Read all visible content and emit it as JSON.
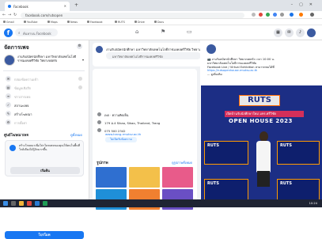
{
  "browser": {
    "tab_title": "Facebook",
    "new_tab": "+",
    "url": "facebook.com/rutsopen",
    "bookmarks": [
      "Gmail",
      "YouTube",
      "Maps",
      "News",
      "Facebook",
      "RUTS",
      "Drive",
      "Docs"
    ]
  },
  "fb": {
    "logo": "f",
    "search_placeholder": "ค้นหาบน Facebook"
  },
  "sidebar": {
    "title": "จัดการเพจ",
    "page_name": "งานรับสมัครนักศึกษา มหาวิทยาลัยเทคโนโลยีราชมงคลศรีวิชัย วิทยาเขตตรัง",
    "items": [
      {
        "label": "กล่องข้อความเข้า",
        "dim": true
      },
      {
        "label": "ข้อมูลเชิงลึก",
        "dim": true
      },
      {
        "label": "ข่าวสารเพจ",
        "dim": true
      },
      {
        "label": "สถานะเพจ",
        "dim": false
      },
      {
        "label": "สร้างโฆษณา",
        "dim": false
      },
      {
        "label": "การตั้งค่า",
        "dim": true
      }
    ],
    "ad_title": "ศูนย์โฆษณาเพจ",
    "ad_info": "ดูทั้งหมด",
    "ad_text": "สร้างโฆษณาเพื่อโปรโมทเพจของคุณให้คนในพื้นที่ใกล้เคียงได้รู้จักมากขึ้น",
    "ad_button": "เริ่มต้น",
    "promote_button": "โปรโมท"
  },
  "composer": {
    "title": "งานรับสมัครนักศึกษา มหาวิทยาลัยเทคโนโลยีราชมงคลศรีวิชัย วิทยาเขตตรัง",
    "placeholder": "มหาวิทยาลัยเทคโนโลยีราชมงคลศรีวิชัย"
  },
  "about": {
    "rows": [
      {
        "text": "เพจ · ความคิดเห็น",
        "link": false
      },
      {
        "text": "179 ม.4 Sikao, Sikao, Thailand, Trang",
        "link": false
      },
      {
        "text": "075 500 2342",
        "link": false
      },
      {
        "text": "www.trang.rmutsv.ac.th",
        "link": true
      }
    ],
    "pill": "ไม่เปิดรับข้อความ"
  },
  "photos": {
    "title": "รูปภาพ",
    "link": "ดูรูปภาพทั้งหมด"
  },
  "feed": {
    "text_lines": [
      "📷 งานรับสมัครนักศึกษา วิทยาเขตตรัง เวลา 10:00 น.",
      "มหาวิทยาลัยเทคโนโลยีราชมงคลศรีวิชัย",
      "Facebook Live / Virtual Exhibition สามารถชมได้ที่",
      "https://rutsopenhouse.rmutsv.ac.th",
      "... ดูเพิ่มเติม"
    ],
    "poster_brand": "RUTS",
    "poster_event": "OPEN HOUSE 2023",
    "poster_band": "เปิดบ้านรับนักศึกษาใหม่ มทร.ศรีวิชัย",
    "small_poster_label": "RUTS"
  },
  "taskbar": {
    "time": "10:24"
  }
}
